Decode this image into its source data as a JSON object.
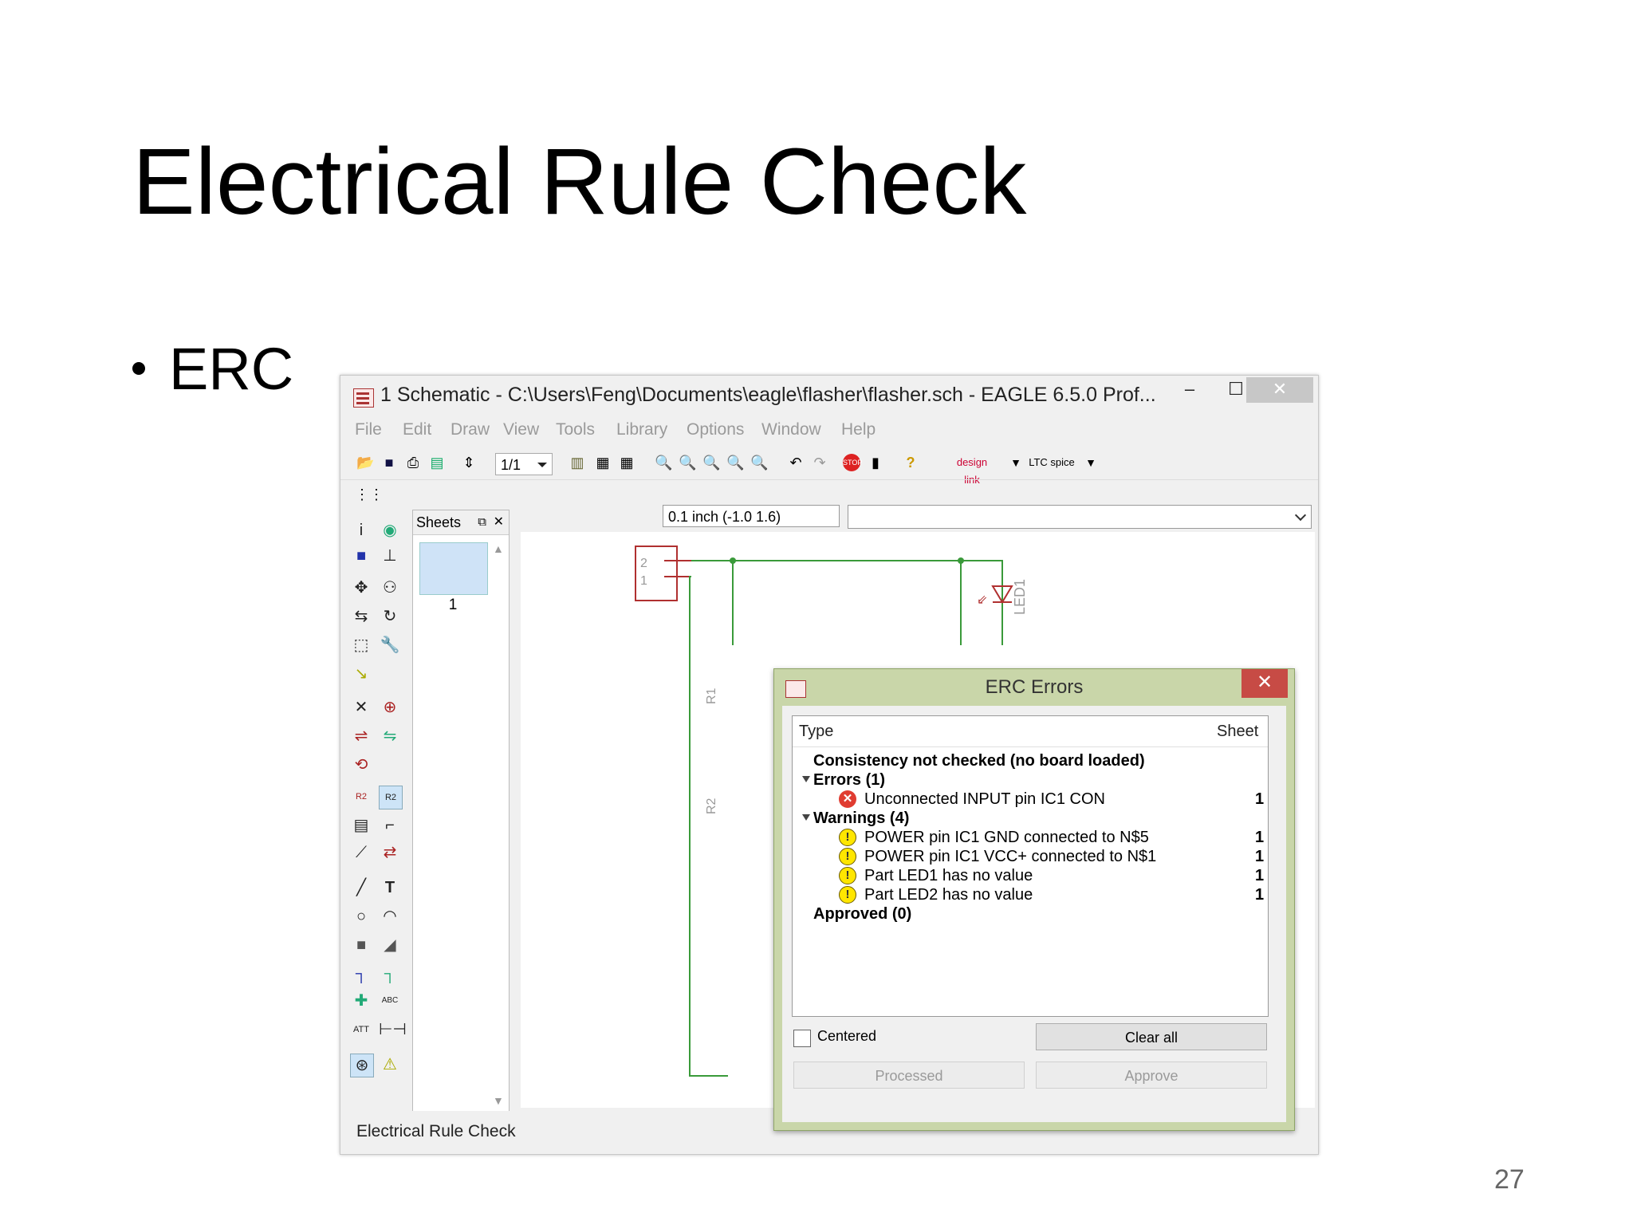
{
  "slide": {
    "title": "Electrical Rule Check",
    "bullet": "ERC",
    "page_number": "27"
  },
  "window": {
    "title": "1 Schematic - C:\\Users\\Feng\\Documents\\eagle\\flasher\\flasher.sch - EAGLE 6.5.0 Prof...",
    "min_label": "–",
    "max_label": "☐",
    "close_label": "✕",
    "menu": [
      "File",
      "Edit",
      "Draw",
      "View",
      "Tools",
      "Library",
      "Options",
      "Window",
      "Help"
    ],
    "sheet_select": "1/1",
    "coordinates": "0.1 inch (-1.0 1.6)",
    "sheets_panel": {
      "header": "Sheets",
      "sheet_number": "1"
    },
    "status": "Electrical Rule Check",
    "toolbar_brands": {
      "designlink": "design link",
      "ltspice": "LTC spice"
    }
  },
  "schematic": {
    "connector_pins": [
      "2",
      "1"
    ],
    "led_label": "LED1",
    "r1_label": "R1",
    "r2_label": "R2",
    "wire_color": "#3a9a3a",
    "part_color": "#b03030"
  },
  "erc": {
    "title": "ERC Errors",
    "close_label": "✕",
    "columns": {
      "type": "Type",
      "sheet": "Sheet"
    },
    "consistency": "Consistency not checked (no board loaded)",
    "errors_header": "Errors (1)",
    "errors": [
      {
        "text": "Unconnected INPUT pin IC1 CON",
        "sheet": "1"
      }
    ],
    "warnings_header": "Warnings (4)",
    "warnings": [
      {
        "text": "POWER pin IC1 GND connected to N$5",
        "sheet": "1"
      },
      {
        "text": "POWER pin IC1 VCC+ connected to N$1",
        "sheet": "1"
      },
      {
        "text": "Part LED1 has no value",
        "sheet": "1"
      },
      {
        "text": "Part LED2 has no value",
        "sheet": "1"
      }
    ],
    "approved_header": "Approved (0)",
    "centered_label": "Centered",
    "clear_all": "Clear all",
    "processed": "Processed",
    "approve": "Approve"
  }
}
